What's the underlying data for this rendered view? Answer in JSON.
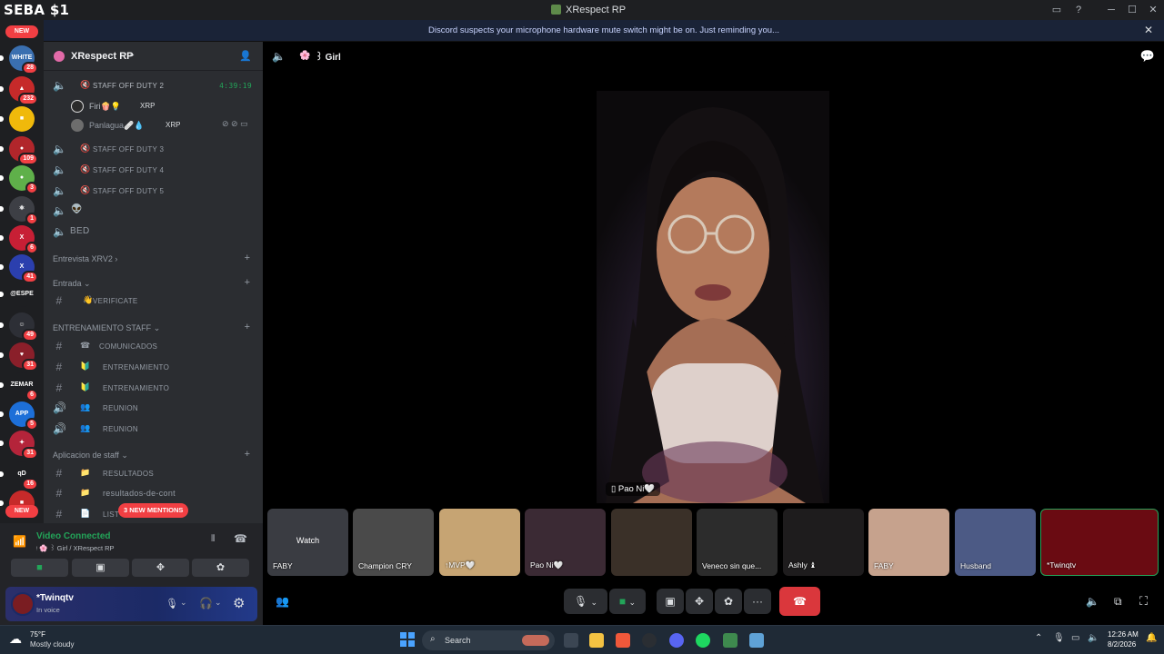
{
  "window": {
    "title": "XRespect RP",
    "stream_owner": "SEBA  $1"
  },
  "notice": {
    "text": "Discord suspects your microphone hardware mute switch might be on. Just reminding you..."
  },
  "rail": {
    "new_top": "NEW",
    "new_bottom": "NEW",
    "servers": [
      {
        "label": "WHITE",
        "badge": "28",
        "color": "#3a6fb0"
      },
      {
        "label": "▲",
        "badge": "232",
        "color": "#c62a2a"
      },
      {
        "label": "■",
        "badge": "",
        "color": "#f0b90b"
      },
      {
        "label": "●",
        "badge": "109",
        "color": "#b1262b"
      },
      {
        "label": "●",
        "badge": "3",
        "color": "#5fb04a"
      },
      {
        "label": "⚛",
        "badge": "1",
        "color": "#3d3f45"
      },
      {
        "label": "X",
        "badge": "6",
        "color": "#c71f35"
      },
      {
        "label": "X",
        "badge": "41",
        "color": "#2b3fae"
      },
      {
        "label": "@ESPE",
        "badge": "",
        "color": "#1e1f22"
      },
      {
        "label": "☺",
        "badge": "49",
        "color": "#2d2f36"
      },
      {
        "label": "♥",
        "badge": "31",
        "color": "#8a1f2a"
      },
      {
        "label": "ZEMAR",
        "badge": "6",
        "color": "#1e1f22"
      },
      {
        "label": "APP",
        "badge": "5",
        "color": "#1d6fd8"
      },
      {
        "label": "✦",
        "badge": "31",
        "color": "#b4243a"
      },
      {
        "label": "qD",
        "badge": "16",
        "color": "#1e1f22"
      },
      {
        "label": "■",
        "badge": "",
        "color": "#c62a2a"
      }
    ]
  },
  "sidebar": {
    "server_name": "XRespect RP",
    "channels": [
      {
        "type": "voice",
        "emoji": "🔇",
        "name": "STAFF OFF DUTY 2",
        "timer": "4:39:19",
        "active": true
      },
      {
        "type": "voice",
        "emoji": "🔇",
        "name": "STAFF OFF DUTY 3"
      },
      {
        "type": "voice",
        "emoji": "🔇",
        "name": "STAFF OFF DUTY 4"
      },
      {
        "type": "voice",
        "emoji": "🔇",
        "name": "STAFF OFF DUTY 5"
      },
      {
        "type": "voice",
        "emoji": "👽",
        "name": ""
      },
      {
        "type": "voice",
        "emoji": "",
        "name": "BED"
      }
    ],
    "members": [
      {
        "name": "Firi🍿💡",
        "tag": "XRP"
      },
      {
        "name": "Panlagua🩹💧",
        "tag": "XRP"
      }
    ],
    "categories": [
      {
        "name": "Entrevista XRV2",
        "chev": "›"
      },
      {
        "name": "Entrada",
        "chev": "⌄"
      },
      {
        "name": "ENTRENAMIENTO STAFF",
        "chev": "⌄"
      },
      {
        "name": "Aplicacion de staff",
        "chev": "⌄"
      }
    ],
    "text_channels": [
      {
        "emoji": "👋",
        "name": "VERIFICATE",
        "kind": "#"
      },
      {
        "emoji": "☎",
        "name": "COMUNICADOS",
        "kind": "#"
      },
      {
        "emoji": "🔰",
        "name": "ENTRENAMIENTO",
        "kind": "#"
      },
      {
        "emoji": "🔰",
        "name": "ENTRENAMIENTO",
        "kind": "#"
      },
      {
        "emoji": "👥",
        "name": "REUNION",
        "kind": "🔊"
      },
      {
        "emoji": "👥",
        "name": "REUNION",
        "kind": "🔊"
      },
      {
        "emoji": "📁",
        "name": "RESULTADOS",
        "kind": "#"
      },
      {
        "emoji": "📁",
        "name": "resultados-de-cont",
        "kind": "#"
      },
      {
        "emoji": "📄",
        "name": "LIST",
        "kind": "#"
      }
    ],
    "mentions": "3 NEW MENTIONS"
  },
  "voice_panel": {
    "status": "Video Connected",
    "location": "ᵎ 🌸 ꒱ Girl / XRespect RP"
  },
  "user": {
    "name": "*Twinqtv",
    "status": "In voice"
  },
  "call": {
    "channel": "꒱ Girl",
    "main_video_name": "Pao Ni🤍",
    "tiles": [
      {
        "label": "FABY",
        "overlay": "Watch",
        "color": "#3a3c42"
      },
      {
        "label": "Champion CRY",
        "color": "#4a4a4a"
      },
      {
        "label": "↑MVP🤍",
        "color": "#c6a473"
      },
      {
        "label": "Pao Ni🤍",
        "color": "#3b2a34"
      },
      {
        "label": "",
        "color": "#3a3028"
      },
      {
        "label": "Veneco sin que...",
        "color": "#2c2c2c"
      },
      {
        "label": "Ashly ♝",
        "color": "#1e1c1d"
      },
      {
        "label": "FABY",
        "color": "#c6a28d"
      },
      {
        "label": "Husband",
        "color": "#4c5a85"
      },
      {
        "label": "*Twinqtv",
        "color": "#6a0b12"
      }
    ]
  },
  "taskbar": {
    "weather_temp": "75°F",
    "weather_desc": "Mostly cloudy",
    "search_placeholder": "Search",
    "time": "12:26 AM",
    "date": "8/2/2026"
  }
}
